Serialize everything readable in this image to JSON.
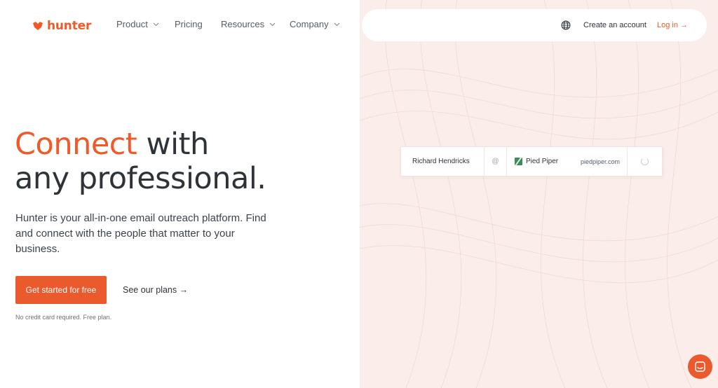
{
  "brand": {
    "name": "hunter",
    "accent_color": "#f05a2a"
  },
  "nav": {
    "items": [
      {
        "label": "Product",
        "has_dropdown": true
      },
      {
        "label": "Pricing",
        "has_dropdown": false
      },
      {
        "label": "Resources",
        "has_dropdown": true
      },
      {
        "label": "Company",
        "has_dropdown": true
      }
    ],
    "language_icon": "globe-icon",
    "create_account": "Create an account",
    "login": "Log in →"
  },
  "hero": {
    "headline_accent": "Connect",
    "headline_rest_line1": " with",
    "headline_line2": "any professional.",
    "subcopy": "Hunter is your all-in-one email outreach platform. Find and connect with the people that matter to your business.",
    "cta_primary": "Get started for free",
    "cta_secondary": "See our plans →",
    "note": "No credit card required. Free plan."
  },
  "search_demo": {
    "name": "Richard Hendricks",
    "at_symbol": "@",
    "company": "Pied Piper",
    "domain": "piedpiper.com",
    "status_icon": "loading-spinner-icon"
  },
  "chat_widget": {
    "icon": "chat-icon",
    "color": "#ea5a2d"
  },
  "colors": {
    "right_panel_bg": "#fbeeea",
    "text_dark": "#2d3339"
  }
}
